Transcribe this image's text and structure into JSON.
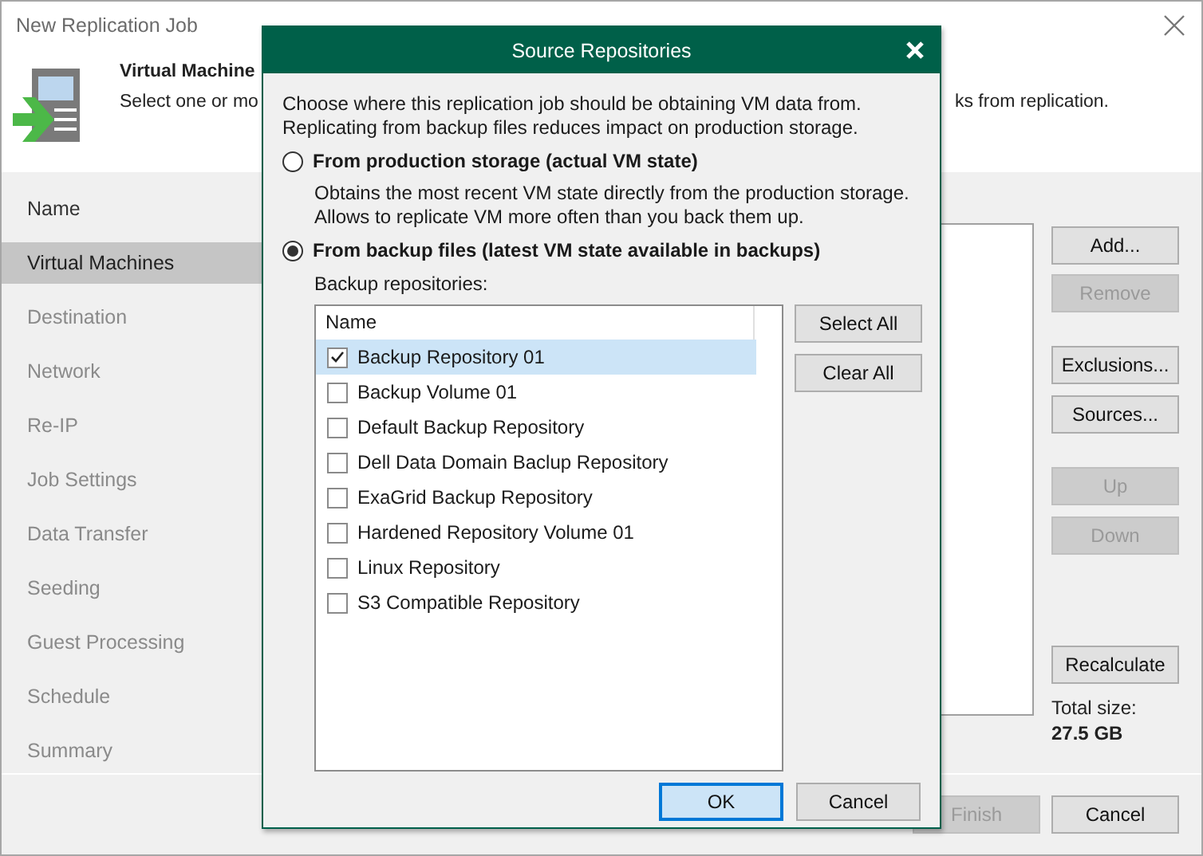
{
  "window": {
    "title": "New Replication Job"
  },
  "header": {
    "title": "Virtual Machine",
    "subtitle_start": "Select one or mo",
    "subtitle_end": "ks from replication."
  },
  "steps": [
    {
      "label": "Name",
      "selected": false,
      "disabled": false
    },
    {
      "label": "Virtual Machines",
      "selected": true,
      "disabled": false
    },
    {
      "label": "Destination",
      "selected": false,
      "disabled": true
    },
    {
      "label": "Network",
      "selected": false,
      "disabled": true
    },
    {
      "label": "Re-IP",
      "selected": false,
      "disabled": true
    },
    {
      "label": "Job Settings",
      "selected": false,
      "disabled": true
    },
    {
      "label": "Data Transfer",
      "selected": false,
      "disabled": true
    },
    {
      "label": "Seeding",
      "selected": false,
      "disabled": true
    },
    {
      "label": "Guest Processing",
      "selected": false,
      "disabled": true
    },
    {
      "label": "Schedule",
      "selected": false,
      "disabled": true
    },
    {
      "label": "Summary",
      "selected": false,
      "disabled": true
    }
  ],
  "side_buttons": [
    {
      "label": "Add...",
      "disabled": false
    },
    {
      "label": "Remove",
      "disabled": true
    },
    {
      "label": "Exclusions...",
      "disabled": false
    },
    {
      "label": "Sources...",
      "disabled": false
    },
    {
      "label": "Up",
      "disabled": true
    },
    {
      "label": "Down",
      "disabled": true
    }
  ],
  "recalculate": {
    "label": "Recalculate",
    "disabled": false
  },
  "total_size": {
    "label": "Total size:",
    "value": "27.5 GB"
  },
  "footer_buttons": [
    {
      "label": "Finish",
      "disabled": true
    },
    {
      "label": "Cancel",
      "disabled": false
    }
  ],
  "dialog": {
    "title": "Source Repositories",
    "intro_lines": [
      "Choose where this replication job should be obtaining VM data from.",
      "Replicating from backup files reduces impact on production storage."
    ],
    "options": [
      {
        "label": "From production storage (actual VM state)",
        "selected": false,
        "description_lines": [
          "Obtains the most recent VM state directly from the production storage.",
          "Allows to replicate VM more often than you back them up."
        ]
      },
      {
        "label": "From backup files (latest VM state available in backups)",
        "selected": true
      }
    ],
    "repositories_label": "Backup repositories:",
    "column": "Name",
    "repositories": [
      {
        "name": "Backup Repository 01",
        "checked": true,
        "selected": true
      },
      {
        "name": "Backup Volume 01",
        "checked": false,
        "selected": false
      },
      {
        "name": "Default Backup Repository",
        "checked": false,
        "selected": false
      },
      {
        "name": "Dell Data Domain Baclup Repository",
        "checked": false,
        "selected": false
      },
      {
        "name": "ExaGrid Backup Repository",
        "checked": false,
        "selected": false
      },
      {
        "name": "Hardened Repository Volume 01",
        "checked": false,
        "selected": false
      },
      {
        "name": "Linux Repository",
        "checked": false,
        "selected": false
      },
      {
        "name": "S3 Compatible Repository",
        "checked": false,
        "selected": false
      }
    ],
    "list_buttons": [
      "Select All",
      "Clear All"
    ],
    "buttons": [
      {
        "label": "OK",
        "default": true
      },
      {
        "label": "Cancel",
        "default": false
      }
    ]
  }
}
